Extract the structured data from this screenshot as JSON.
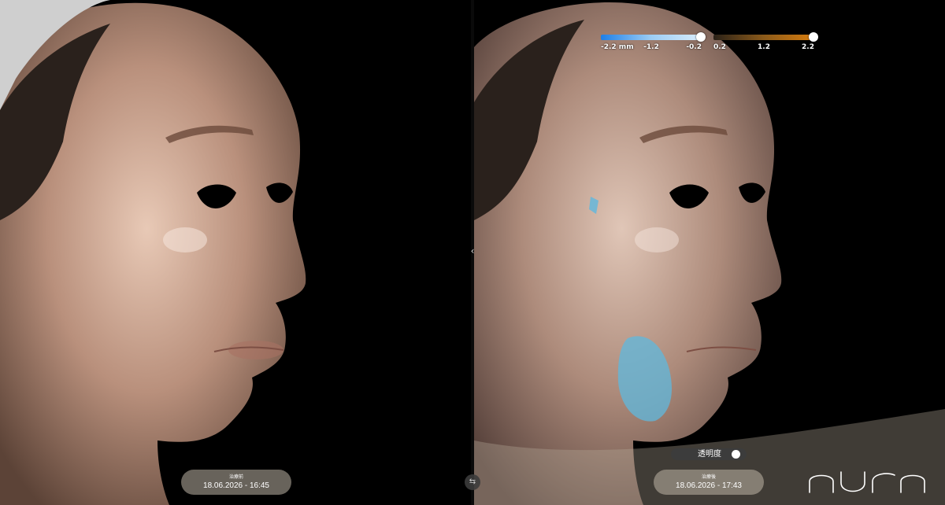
{
  "app": {
    "brand": "AURA"
  },
  "legend_depth": {
    "min": "-2.2 mm",
    "mid": "-1.2",
    "max": "-0.2",
    "color_start": "#1e7fe8",
    "color_end": "#d9ecfb"
  },
  "legend_raise": {
    "min": "0.2",
    "mid": "1.2",
    "max": "2.2",
    "color_start": "#2a2118",
    "color_end": "#d87d0e"
  },
  "before": {
    "label": "治療前",
    "datetime": "18.06.2026 - 16:45"
  },
  "after": {
    "label": "治療後",
    "datetime": "18.06.2026 - 17:43"
  },
  "opacity": {
    "label": "透明度",
    "enabled": true
  },
  "icons": {
    "collapse": "chevron-left-icon",
    "swap": "swap-arrows-icon"
  }
}
